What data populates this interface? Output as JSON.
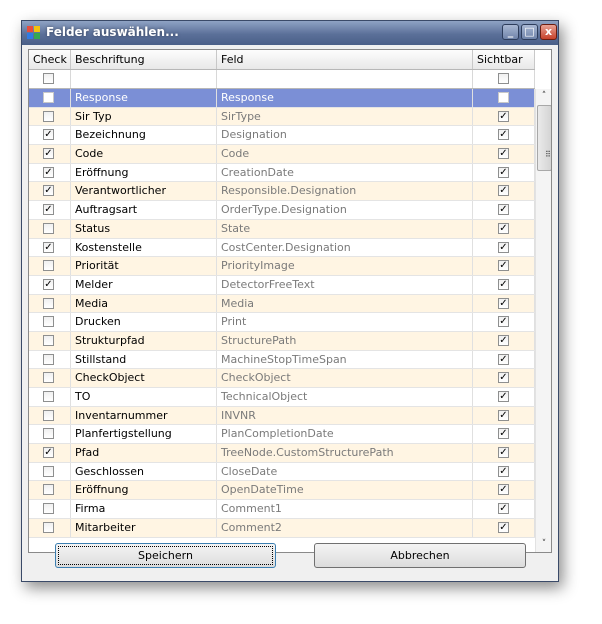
{
  "window": {
    "title": "Felder auswählen...",
    "min_glyph": "_",
    "max_glyph": "□",
    "close_glyph": "x"
  },
  "icon_colors": [
    "#e84c3d",
    "#f4c20d",
    "#2f7be5",
    "#34a853"
  ],
  "columns": {
    "check": "Check",
    "caption": "Beschriftung",
    "field": "Feld",
    "visible": "Sichtbar"
  },
  "rows": [
    {
      "caption": "Response",
      "field": "Response",
      "checked": false,
      "visible": false,
      "selected": true
    },
    {
      "caption": "Sir Typ",
      "field": "SirType",
      "checked": false,
      "visible": true
    },
    {
      "caption": "Bezeichnung",
      "field": "Designation",
      "checked": true,
      "visible": true
    },
    {
      "caption": "Code",
      "field": "Code",
      "checked": true,
      "visible": true
    },
    {
      "caption": "Eröffnung",
      "field": "CreationDate",
      "checked": true,
      "visible": true
    },
    {
      "caption": "Verantwortlicher",
      "field": "Responsible.Designation",
      "checked": true,
      "visible": true
    },
    {
      "caption": "Auftragsart",
      "field": "OrderType.Designation",
      "checked": true,
      "visible": true
    },
    {
      "caption": "Status",
      "field": "State",
      "checked": false,
      "visible": true
    },
    {
      "caption": "Kostenstelle",
      "field": "CostCenter.Designation",
      "checked": true,
      "visible": true
    },
    {
      "caption": "Priorität",
      "field": "PriorityImage",
      "checked": false,
      "visible": true
    },
    {
      "caption": "Melder",
      "field": "DetectorFreeText",
      "checked": true,
      "visible": true
    },
    {
      "caption": "Media",
      "field": "Media",
      "checked": false,
      "visible": true
    },
    {
      "caption": "Drucken",
      "field": "Print",
      "checked": false,
      "visible": true
    },
    {
      "caption": "Strukturpfad",
      "field": "StructurePath",
      "checked": false,
      "visible": true
    },
    {
      "caption": "Stillstand",
      "field": "MachineStopTimeSpan",
      "checked": false,
      "visible": true
    },
    {
      "caption": "CheckObject",
      "field": "CheckObject",
      "checked": false,
      "visible": true
    },
    {
      "caption": "TO",
      "field": "TechnicalObject",
      "checked": false,
      "visible": true
    },
    {
      "caption": "Inventarnummer",
      "field": "INVNR",
      "checked": false,
      "visible": true
    },
    {
      "caption": "Planfertigstellung",
      "field": "PlanCompletionDate",
      "checked": false,
      "visible": true
    },
    {
      "caption": "Pfad",
      "field": "TreeNode.CustomStructurePath",
      "checked": true,
      "visible": true
    },
    {
      "caption": "Geschlossen",
      "field": "CloseDate",
      "checked": false,
      "visible": true
    },
    {
      "caption": "Eröffnung",
      "field": "OpenDateTime",
      "checked": false,
      "visible": true
    },
    {
      "caption": "Firma",
      "field": "Comment1",
      "checked": false,
      "visible": true
    },
    {
      "caption": "Mitarbeiter",
      "field": "Comment2",
      "checked": false,
      "visible": true
    }
  ],
  "check_glyph": "✓",
  "scroll": {
    "up_glyph": "˄",
    "down_glyph": "˅",
    "grip_glyph": "⠿"
  },
  "buttons": {
    "save": "Speichern",
    "cancel": "Abbrechen"
  },
  "colors": {
    "selection": "#7b8fd6",
    "alt_row": "#fff5e3",
    "titlebar": "#5b7099"
  }
}
